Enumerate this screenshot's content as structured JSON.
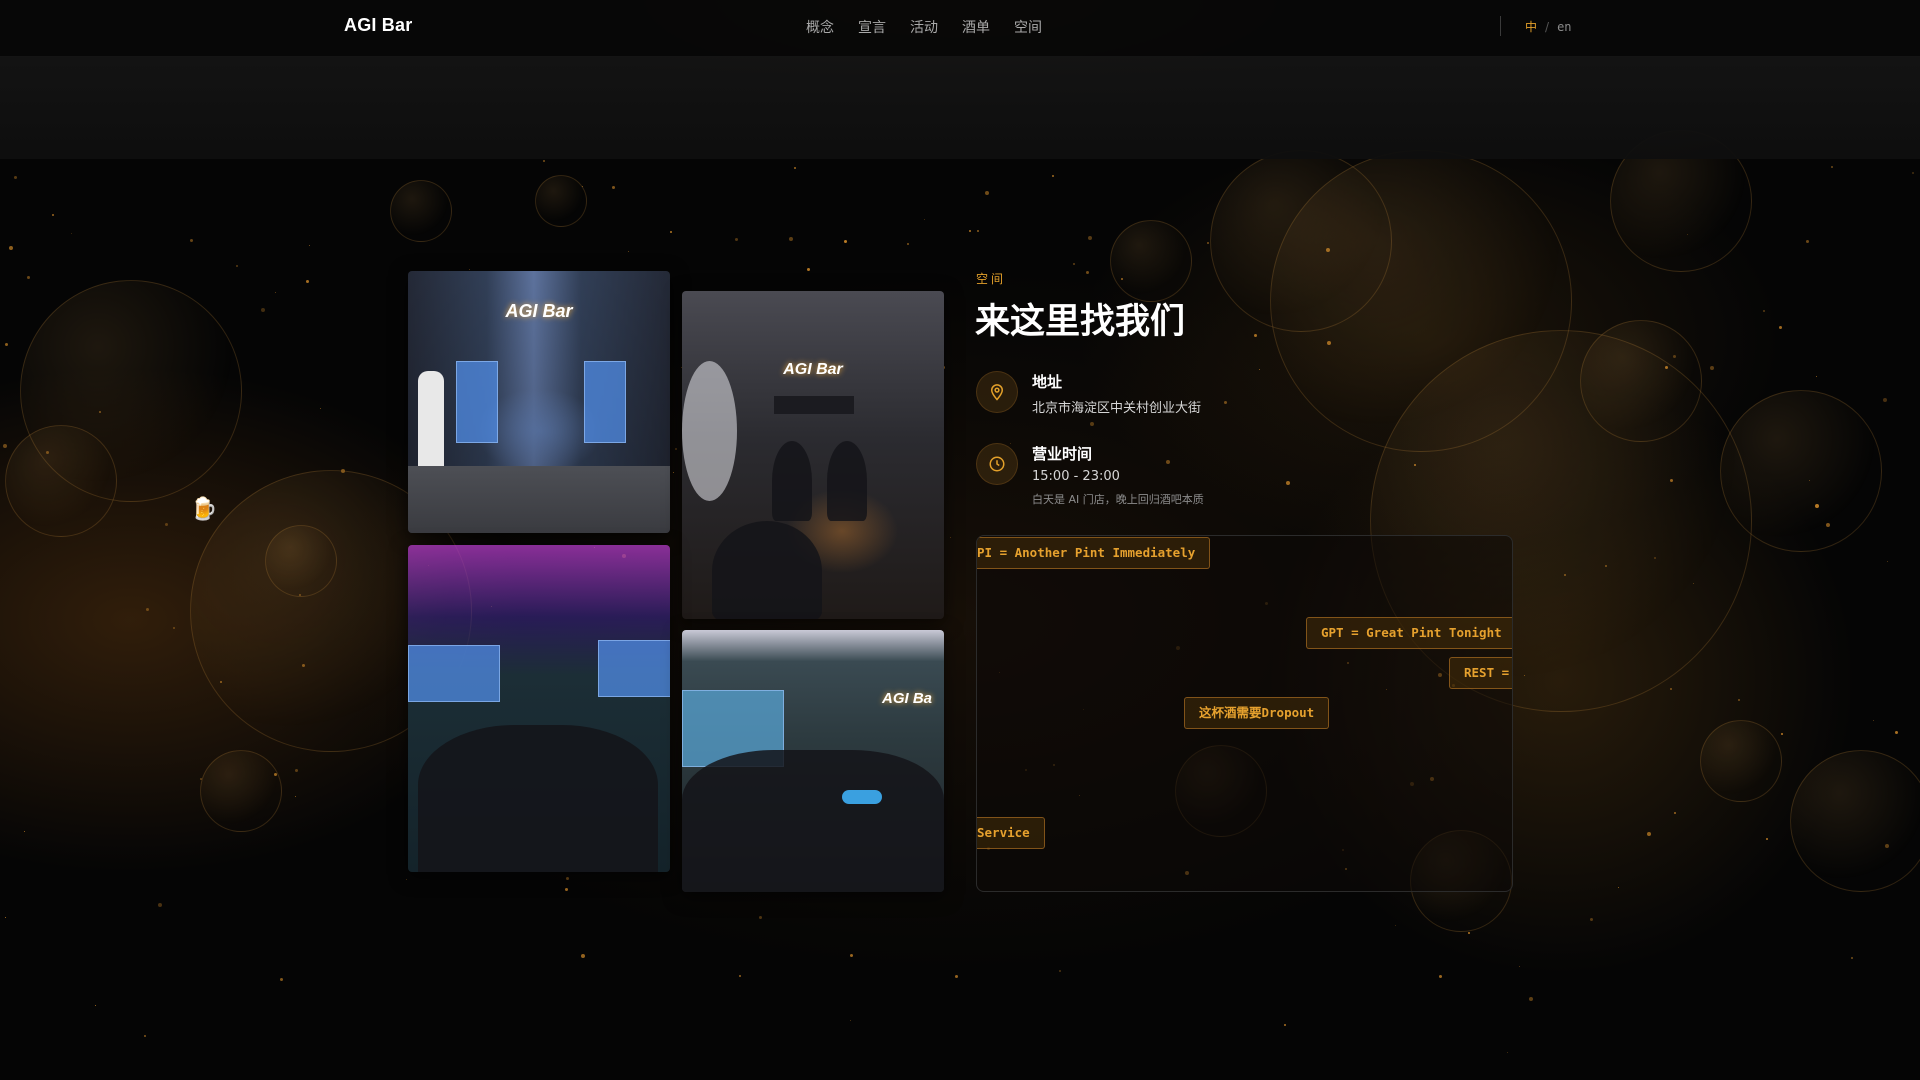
{
  "header": {
    "logo": "AGI Bar",
    "nav": [
      "概念",
      "宣言",
      "活动",
      "酒单",
      "空间"
    ],
    "lang_active": "中",
    "lang_sep": "/",
    "lang_other": "en"
  },
  "decor": {
    "mug_icon": "beer-mug-icon"
  },
  "photos": {
    "photo1_sign": "AGI Bar",
    "photo2_sign": "AGI Bar",
    "photo4_sign": "AGI Ba"
  },
  "section": {
    "eyebrow": "空间",
    "title": "来这里找我们",
    "address_label": "地址",
    "address_value": "北京市海淀区中关村创业大街",
    "hours_label": "营业时间",
    "hours_value": "15:00 - 23:00",
    "hours_note": "白天是 AI 门店，晚上回归酒吧本质"
  },
  "tags": [
    "PI = Another Pint Immediately",
    "GPT = Great Pint Tonight",
    "REST =",
    "这杯酒需要Dropout",
    "Service"
  ],
  "colors": {
    "accent": "#e3a02a",
    "background": "#050505"
  }
}
